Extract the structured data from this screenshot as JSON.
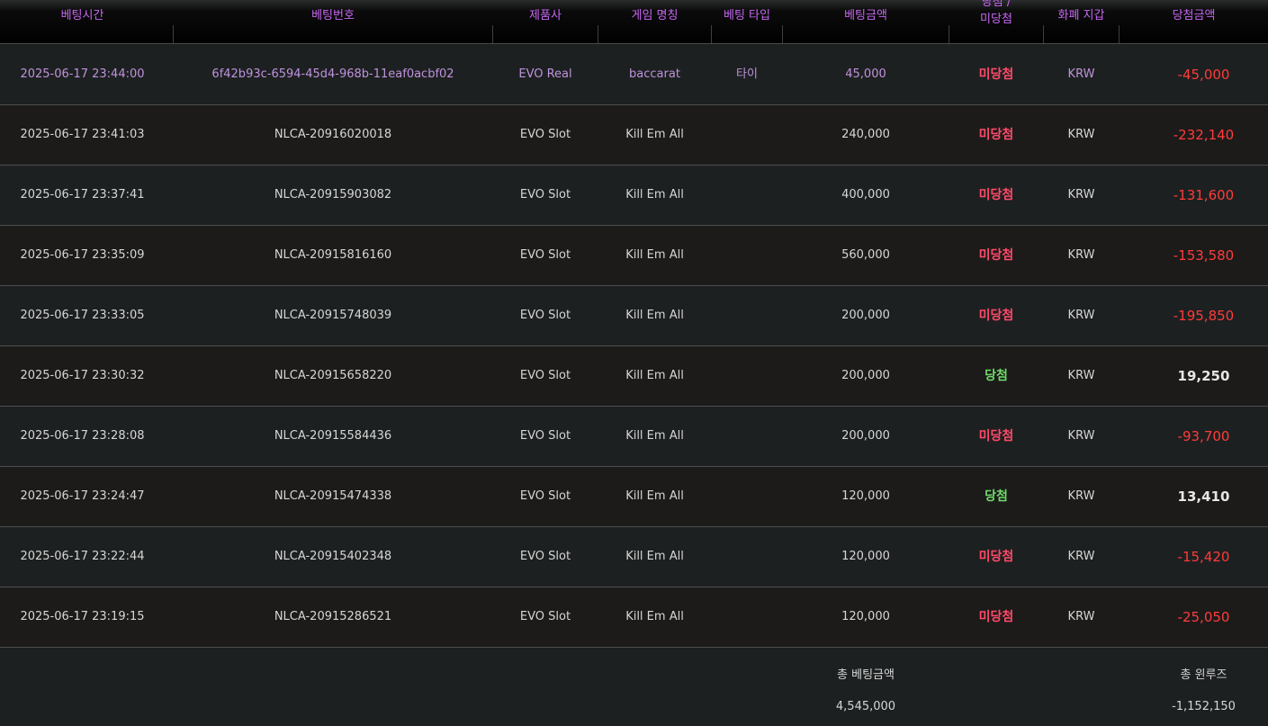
{
  "columns": {
    "bet_time": "베팅시간",
    "bet_id": "베팅번호",
    "vendor": "제품사",
    "game": "게임 명칭",
    "bet_type": "베팅 타입",
    "bet_amount": "베팅금액",
    "result_line1": "당첨 /",
    "result_line2": "미당첨",
    "currency": "화폐 지갑",
    "win_amount": "당첨금액"
  },
  "rows": [
    {
      "time": "2025-06-17 23:44:00",
      "id": "6f42b93c-6594-45d4-968b-11eaf0acbf02",
      "vendor": "EVO Real",
      "game": "baccarat",
      "type": "타이",
      "amount": "45,000",
      "result": "미당첨",
      "currency": "KRW",
      "win": "-45,000"
    },
    {
      "time": "2025-06-17 23:41:03",
      "id": "NLCA-20916020018",
      "vendor": "EVO Slot",
      "game": "Kill Em All",
      "type": "",
      "amount": "240,000",
      "result": "미당첨",
      "currency": "KRW",
      "win": "-232,140"
    },
    {
      "time": "2025-06-17 23:37:41",
      "id": "NLCA-20915903082",
      "vendor": "EVO Slot",
      "game": "Kill Em All",
      "type": "",
      "amount": "400,000",
      "result": "미당첨",
      "currency": "KRW",
      "win": "-131,600"
    },
    {
      "time": "2025-06-17 23:35:09",
      "id": "NLCA-20915816160",
      "vendor": "EVO Slot",
      "game": "Kill Em All",
      "type": "",
      "amount": "560,000",
      "result": "미당첨",
      "currency": "KRW",
      "win": "-153,580"
    },
    {
      "time": "2025-06-17 23:33:05",
      "id": "NLCA-20915748039",
      "vendor": "EVO Slot",
      "game": "Kill Em All",
      "type": "",
      "amount": "200,000",
      "result": "미당첨",
      "currency": "KRW",
      "win": "-195,850"
    },
    {
      "time": "2025-06-17 23:30:32",
      "id": "NLCA-20915658220",
      "vendor": "EVO Slot",
      "game": "Kill Em All",
      "type": "",
      "amount": "200,000",
      "result": "당첨",
      "currency": "KRW",
      "win": "19,250"
    },
    {
      "time": "2025-06-17 23:28:08",
      "id": "NLCA-20915584436",
      "vendor": "EVO Slot",
      "game": "Kill Em All",
      "type": "",
      "amount": "200,000",
      "result": "미당첨",
      "currency": "KRW",
      "win": "-93,700"
    },
    {
      "time": "2025-06-17 23:24:47",
      "id": "NLCA-20915474338",
      "vendor": "EVO Slot",
      "game": "Kill Em All",
      "type": "",
      "amount": "120,000",
      "result": "당첨",
      "currency": "KRW",
      "win": "13,410"
    },
    {
      "time": "2025-06-17 23:22:44",
      "id": "NLCA-20915402348",
      "vendor": "EVO Slot",
      "game": "Kill Em All",
      "type": "",
      "amount": "120,000",
      "result": "미당첨",
      "currency": "KRW",
      "win": "-15,420"
    },
    {
      "time": "2025-06-17 23:19:15",
      "id": "NLCA-20915286521",
      "vendor": "EVO Slot",
      "game": "Kill Em All",
      "type": "",
      "amount": "120,000",
      "result": "미당첨",
      "currency": "KRW",
      "win": "-25,050"
    }
  ],
  "summary": {
    "total_bet_label": "총 베팅금액",
    "total_bet_value": "4,545,000",
    "total_winloss_label": "총 윈루즈",
    "total_winloss_value": "-1,152,150"
  },
  "colors": {
    "header_text": "#c766f2",
    "lose": "#ff4a6a",
    "win": "#6fdc6a",
    "negative_amount": "#ff3b3b"
  }
}
